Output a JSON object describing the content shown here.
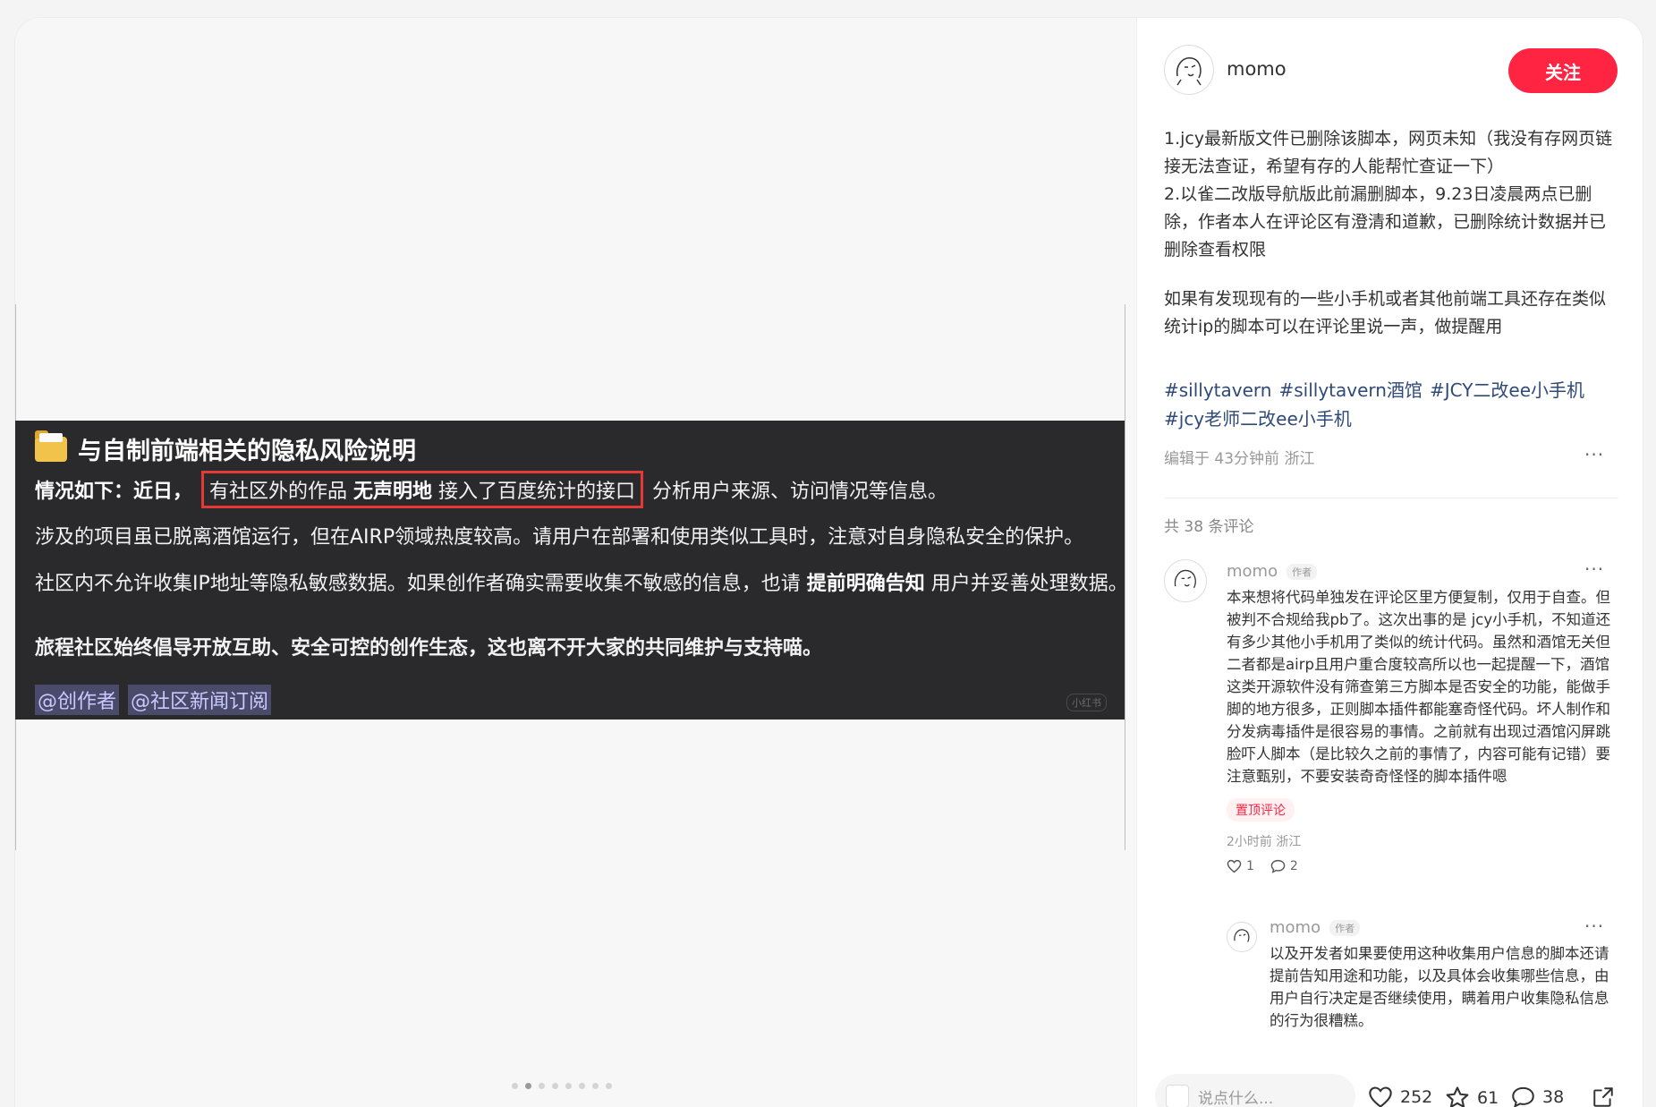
{
  "post_image": {
    "title": "与自制前端相关的隐私风险说明",
    "line1_pre": "情况如下：近日，",
    "line1_box_a": "有社区外的作品 ",
    "line1_box_b": "无声明地",
    "line1_box_c": " 接入了百度统计的接口",
    "line1_post": "分析用户来源、访问情况等信息。",
    "line2": "涉及的项目虽已脱离酒馆运行，但在AIRP领域热度较高。请用户在部署和使用类似工具时，注意对自身隐私安全的保护。",
    "line3_pre": "社区内不允许收集IP地址等隐私敏感数据。如果创作者确实需要收集不敏感的信息，也请 ",
    "line3_bold": "提前明确告知",
    "line3_post": " 用户并妥善处理数据。",
    "line4": "旅程社区始终倡导开放互助、安全可控的创作生态，这也离不开大家的共同维护与支持喵。",
    "tag1": "@创作者",
    "tag2": "@社区新闻订阅",
    "watermark": "小红书"
  },
  "header": {
    "author": "momo",
    "follow_label": "关注"
  },
  "content": {
    "p1": "1.jcy最新版文件已删除该脚本，网页未知（我没有存网页链接无法查证，希望有存的人能帮忙查证一下）",
    "p2": "2.以雀二改版导航版此前漏删脚本，9.23日凌晨两点已删除，作者本人在评论区有澄清和道歉，已删除统计数据并已删除查看权限",
    "p3": "如果有发现现有的一些小手机或者其他前端工具还存在类似统计ip的脚本可以在评论里说一声，做提醒用"
  },
  "hashtags": [
    "#sillytavern",
    "#sillytavern酒馆",
    "#JCY二改ee小手机",
    "#jcy老师二改ee小手机"
  ],
  "meta": "编辑于 43分钟前 浙江",
  "comment_count": "共 38 条评论",
  "comment1": {
    "name": "momo",
    "badge": "作者",
    "text": "本来想将代码单独发在评论区里方便复制，仅用于自查。但被判不合规给我pb了。这次出事的是 jcy小手机，不知道还有多少其他小手机用了类似的统计代码。虽然和酒馆无关但二者都是airp且用户重合度较高所以也一起提醒一下，酒馆这类开源软件没有筛查第三方脚本是否安全的功能，能做手脚的地方很多，正则脚本插件都能塞奇怪代码。坏人制作和分发病毒插件是很容易的事情。之前就有出现过酒馆闪屏跳脸吓人脚本（是比较久之前的事情了，内容可能有记错）要注意甄别，不要安装奇奇怪怪的脚本插件嗯",
    "pin": "置顶评论",
    "time": "2小时前 浙江",
    "likes": "1",
    "replies": "2"
  },
  "reply1": {
    "name": "momo",
    "badge": "作者",
    "text": "以及开发者如果要使用这种收集用户信息的脚本还请提前告知用途和功能，以及具体会收集哪些信息，由用户自行决定是否继续使用，瞒着用户收集隐私信息的行为很糟糕。"
  },
  "bottom": {
    "placeholder": "说点什么...",
    "likes": "252",
    "stars": "61",
    "comments": "38"
  },
  "colors": {
    "accent": "#ff2442",
    "hashtag": "#2f4a79"
  }
}
